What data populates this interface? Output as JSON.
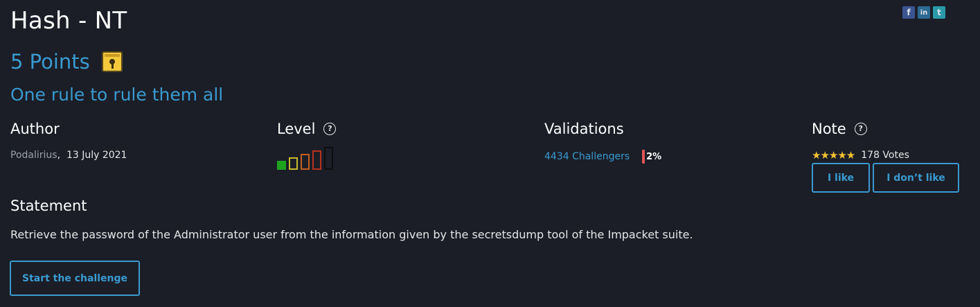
{
  "title": "Hash - NT",
  "points_label": "5 Points",
  "subtitle": "One rule to rule them all",
  "social": {
    "facebook_glyph": "f",
    "linkedin_glyph": "in",
    "twitter_glyph": "t",
    "icons": [
      "facebook-icon",
      "linkedin-icon",
      "twitter-icon"
    ]
  },
  "author": {
    "heading": "Author",
    "name": "Podalirius",
    "separator": ",",
    "date": "13 July 2021"
  },
  "level": {
    "heading": "Level",
    "help_glyph": "?",
    "current": 1,
    "max": 5,
    "colors": [
      "#1fa31f",
      "#c6b92b",
      "#c2601f",
      "#b8321f",
      "#0e0e0e"
    ]
  },
  "validations": {
    "heading": "Validations",
    "challengers": "4434 Challengers",
    "percent": "2%",
    "percent_value": 0.02,
    "bar_color": "#e05555"
  },
  "note": {
    "heading": "Note",
    "help_glyph": "?",
    "stars": "★★★★★",
    "rating": 5,
    "votes": "178 Votes",
    "like_label": "I like",
    "dislike_label": "I don’t like"
  },
  "statement": {
    "heading": "Statement",
    "text": "Retrieve the password of the Administrator user from the information given by the secretsdump tool of the Impacket suite."
  },
  "start_button": "Start the challenge",
  "colors": {
    "background": "#1b1e27",
    "accent": "#3a9ad0",
    "star": "#f2c233"
  }
}
